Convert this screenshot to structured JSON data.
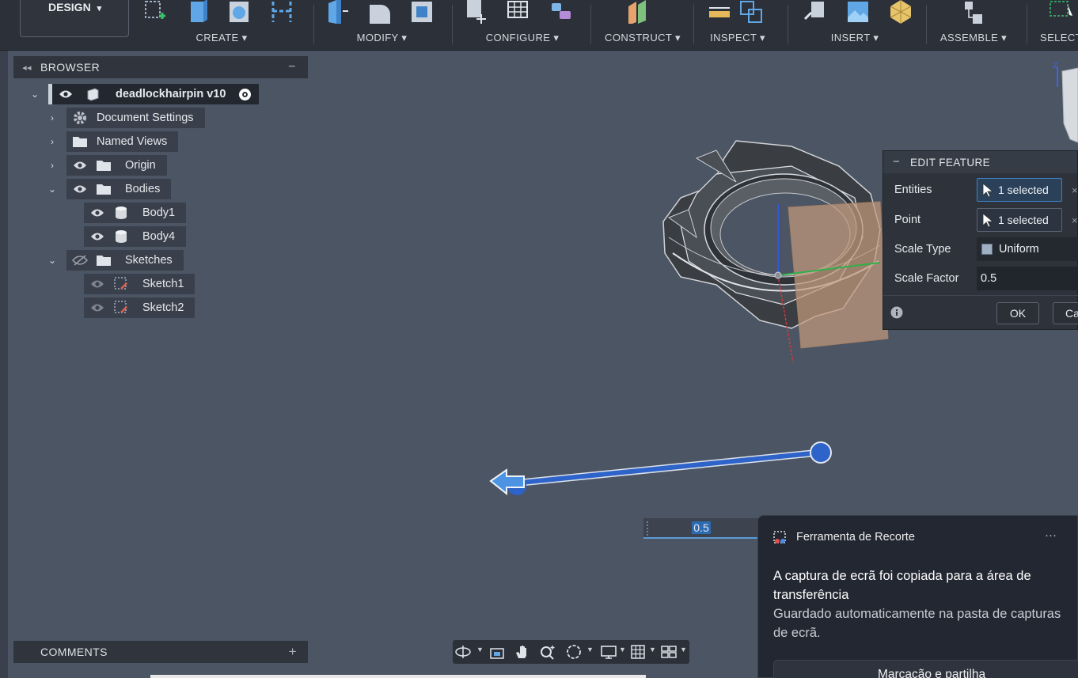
{
  "workspace": {
    "label": "DESIGN",
    "caret": "▾"
  },
  "toolbar": {
    "groups": [
      {
        "label": "CREATE ▾"
      },
      {
        "label": "MODIFY ▾"
      },
      {
        "label": "CONFIGURE ▾"
      },
      {
        "label": "CONSTRUCT ▾"
      },
      {
        "label": "INSPECT ▾"
      },
      {
        "label": "INSERT ▾"
      },
      {
        "label": "ASSEMBLE ▾"
      },
      {
        "label": "SELECT"
      }
    ]
  },
  "browser": {
    "title": "BROWSER",
    "collapse_glyph": "◂◂",
    "minimize_glyph": "−",
    "root": {
      "label": "deadlockhairpin v10"
    },
    "items": [
      {
        "label": "Document Settings",
        "icon": "gear-icon"
      },
      {
        "label": "Named Views",
        "icon": "folder-icon"
      },
      {
        "label": "Origin",
        "icon": "folder-icon"
      },
      {
        "label": "Bodies",
        "icon": "folder-icon"
      },
      {
        "label": "Body1",
        "icon": "body-icon"
      },
      {
        "label": "Body4",
        "icon": "body-icon"
      },
      {
        "label": "Sketches",
        "icon": "folder-icon"
      },
      {
        "label": "Sketch1",
        "icon": "sketch-icon"
      },
      {
        "label": "Sketch2",
        "icon": "sketch-icon"
      }
    ]
  },
  "comments": {
    "label": "COMMENTS",
    "add_glyph": "+"
  },
  "edit_feature": {
    "title": "EDIT FEATURE",
    "rows": {
      "entities": {
        "label": "Entities",
        "value": "1 selected"
      },
      "point": {
        "label": "Point",
        "value": "1 selected"
      },
      "scale_type": {
        "label": "Scale Type",
        "value": "Uniform"
      },
      "scale_factor": {
        "label": "Scale Factor",
        "value": "0.5"
      }
    },
    "ok_label": "OK",
    "cancel_label": "Ca",
    "clear_glyph": "×"
  },
  "dimension_input": {
    "value": "0.5"
  },
  "toast": {
    "app_name": "Ferramenta de Recorte",
    "more_glyph": "···",
    "title": "A captura de ecrã foi copiada para a área de transferência",
    "body": "Guardado automaticamente na pasta de capturas de ecrã.",
    "action_label": "Marcação e partilha"
  },
  "colors": {
    "toolbar_bg": "#2b3039",
    "viewport_bg": "#4c5564",
    "accent_blue": "#3f82c7",
    "manipulator_blue": "#2e63c9",
    "plane_orange": "#c49a7c"
  }
}
